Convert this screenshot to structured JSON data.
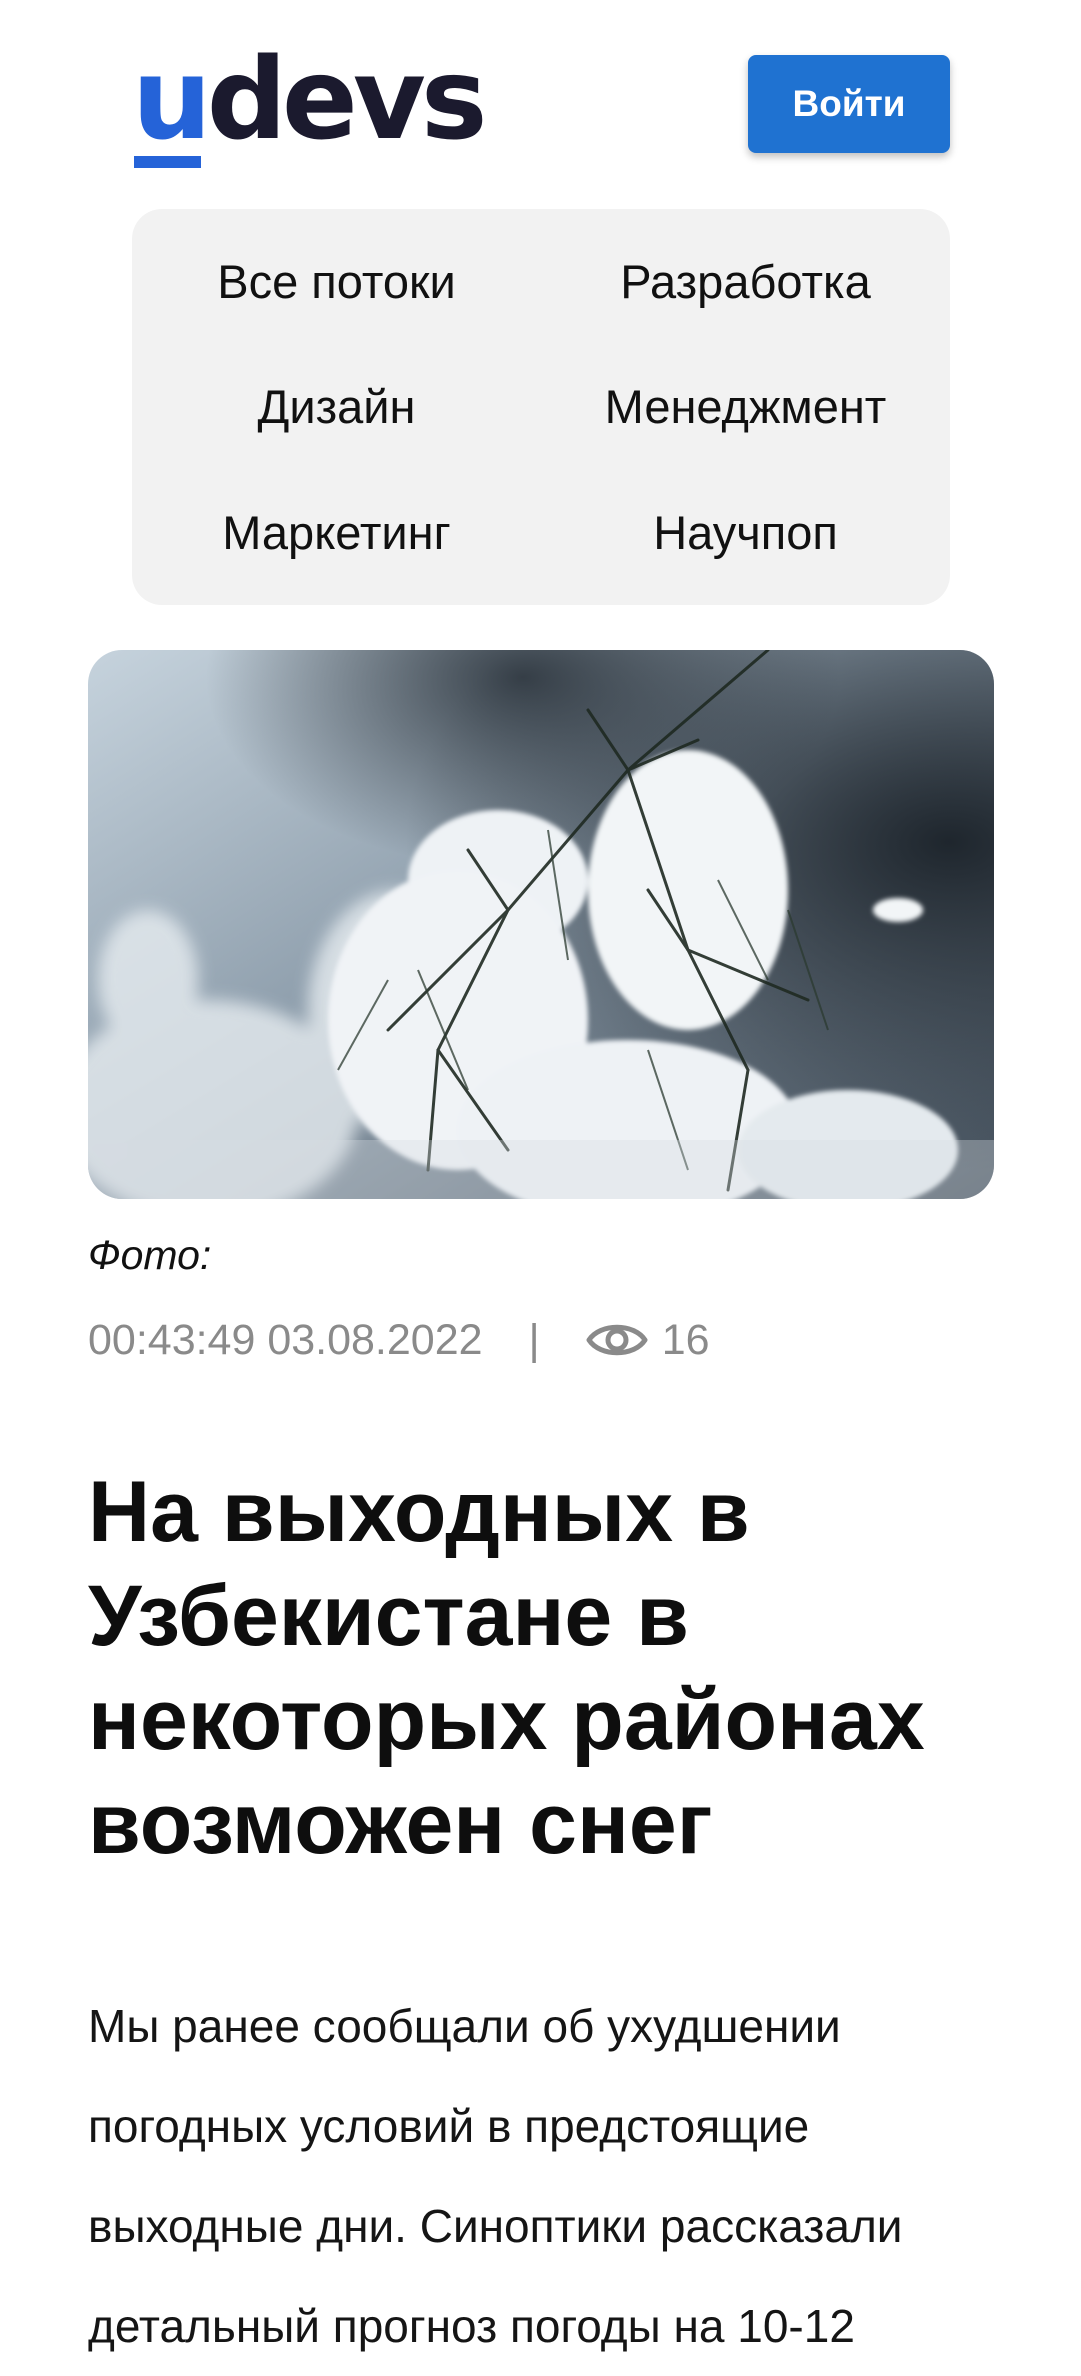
{
  "header": {
    "logo_first": "u",
    "logo_rest": "devs",
    "login_label": "Войти",
    "accent_color": "#1f72d1"
  },
  "streams": [
    {
      "label": "Все потоки"
    },
    {
      "label": "Разработка"
    },
    {
      "label": "Дизайн"
    },
    {
      "label": "Менеджмент"
    },
    {
      "label": "Маркетинг"
    },
    {
      "label": "Научпоп"
    }
  ],
  "article": {
    "photo_caption": "Фото:",
    "datetime": "00:43:49 03.08.2022",
    "separator": "|",
    "views_icon": "eye-icon",
    "views": "16",
    "title": "На выходных в Узбекистане в некоторых районах возможен снег",
    "body": "Мы ранее сообщали об ухудшении погодных условий в предстоящие выходные дни. Синоптики рассказали детальный прогноз погоды на 10-12"
  }
}
